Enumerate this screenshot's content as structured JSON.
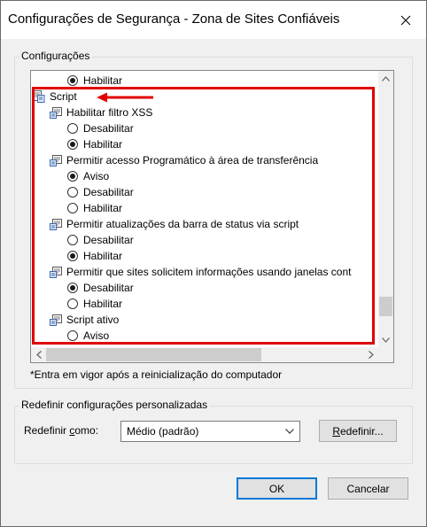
{
  "window": {
    "title": "Configurações de Segurança - Zona de Sites Confiáveis"
  },
  "settings_group": {
    "legend": "Configurações",
    "items": [
      {
        "type": "radio",
        "label": "Habilitar",
        "checked": true
      },
      {
        "type": "category",
        "label": "Script",
        "icon": "script-settings-icon"
      },
      {
        "type": "setting",
        "label": "Habilitar filtro XSS",
        "icon": "setting-icon"
      },
      {
        "type": "radio",
        "label": "Desabilitar",
        "checked": false
      },
      {
        "type": "radio",
        "label": "Habilitar",
        "checked": true
      },
      {
        "type": "setting",
        "label": "Permitir acesso Programático à área de transferência",
        "icon": "setting-icon"
      },
      {
        "type": "radio",
        "label": "Aviso",
        "checked": true
      },
      {
        "type": "radio",
        "label": "Desabilitar",
        "checked": false
      },
      {
        "type": "radio",
        "label": "Habilitar",
        "checked": false
      },
      {
        "type": "setting",
        "label": "Permitir atualizações da barra de status via script",
        "icon": "setting-icon"
      },
      {
        "type": "radio",
        "label": "Desabilitar",
        "checked": false
      },
      {
        "type": "radio",
        "label": "Habilitar",
        "checked": true
      },
      {
        "type": "setting",
        "label": "Permitir que sites solicitem informações usando janelas cont",
        "icon": "setting-icon"
      },
      {
        "type": "radio",
        "label": "Desabilitar",
        "checked": true
      },
      {
        "type": "radio",
        "label": "Habilitar",
        "checked": false
      },
      {
        "type": "setting",
        "label": "Script ativo",
        "icon": "setting-icon"
      },
      {
        "type": "radio",
        "label": "Aviso",
        "checked": false
      }
    ],
    "footnote": "*Entra em vigor após a reinicialização do computador"
  },
  "annotation": {
    "color": "#e00000"
  },
  "reset_group": {
    "legend": "Redefinir configurações personalizadas",
    "label_prefix": "Redefinir ",
    "label_underlined": "c",
    "label_suffix": "omo:",
    "select_value": "Médio (padrão)",
    "button_underlined": "R",
    "button_rest": "edefinir..."
  },
  "buttons": {
    "ok": "OK",
    "cancel": "Cancelar"
  },
  "accent": "#0078d7"
}
